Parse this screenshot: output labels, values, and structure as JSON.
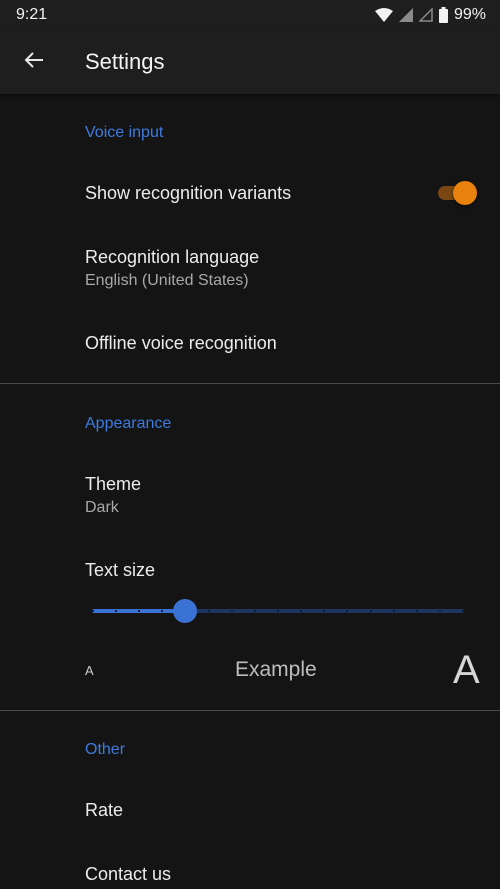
{
  "status_bar": {
    "time": "9:21",
    "battery_percent": "99%",
    "icons": [
      "wifi-icon",
      "cell-signal-icon",
      "cell-signal-empty-icon",
      "battery-icon"
    ]
  },
  "appbar": {
    "title": "Settings",
    "back_icon": "arrow-back-icon"
  },
  "sections": {
    "voice_input": {
      "title": "Voice input",
      "show_variants": {
        "label": "Show recognition variants",
        "enabled": true
      },
      "language": {
        "label": "Recognition language",
        "value": "English (United States)"
      },
      "offline": {
        "label": "Offline voice recognition"
      }
    },
    "appearance": {
      "title": "Appearance",
      "theme": {
        "label": "Theme",
        "value": "Dark"
      },
      "text_size": {
        "label": "Text size",
        "level_fraction": 0.25,
        "small_sample": "A",
        "example": "Example",
        "large_sample": "A"
      }
    },
    "other": {
      "title": "Other",
      "rate": {
        "label": "Rate"
      },
      "contact": {
        "label": "Contact us"
      }
    }
  },
  "colors": {
    "accent_blue": "#3a72d4",
    "section_blue": "#3d7be0",
    "toggle_orange": "#e8820c",
    "background": "#141414",
    "appbar": "#1e1e1e"
  }
}
